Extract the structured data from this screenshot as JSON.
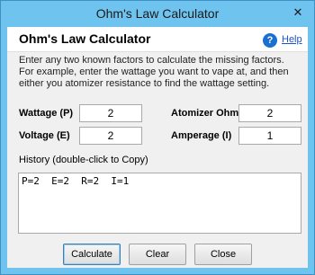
{
  "window": {
    "title": "Ohm's Law Calculator",
    "close_glyph": "✕"
  },
  "header": {
    "title": "Ohm's Law Calculator",
    "help_icon_glyph": "?",
    "help_link": "Help"
  },
  "description": "Enter any two known factors to calculate the missing factors. For example, enter the wattage you want to vape at, and then either you atomizer resistance to find the wattage setting.",
  "fields": {
    "wattage": {
      "label": "Wattage (P)",
      "value": "2"
    },
    "atomizer_ohms": {
      "label": "Atomizer Ohms (R)",
      "value": "2"
    },
    "voltage": {
      "label": "Voltage (E)",
      "value": "2"
    },
    "amperage": {
      "label": "Amperage (I)",
      "value": "1"
    }
  },
  "history": {
    "label": "History (double-click to Copy)",
    "text": "P=2  E=2  R=2  I=1"
  },
  "buttons": {
    "calculate": "Calculate",
    "clear": "Clear",
    "close": "Close"
  }
}
